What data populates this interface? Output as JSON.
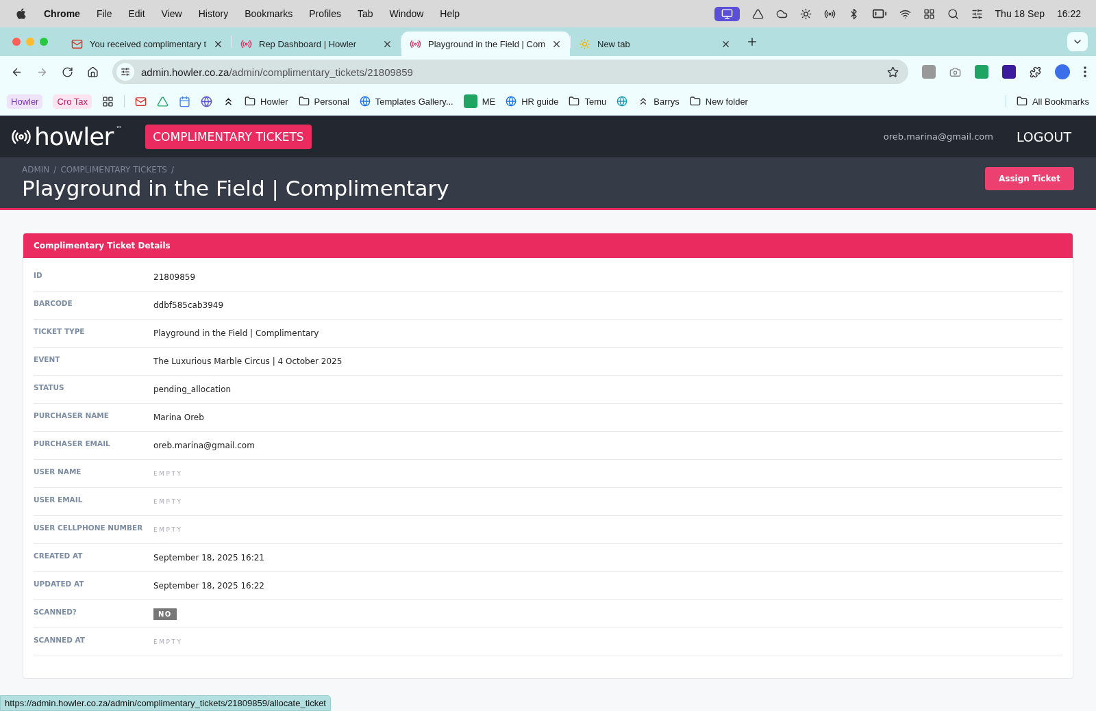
{
  "menu_bar": {
    "app": "Chrome",
    "menus": [
      "File",
      "Edit",
      "View",
      "History",
      "Bookmarks",
      "Profiles",
      "Tab",
      "Window",
      "Help"
    ],
    "date": "Thu 18 Sep",
    "time": "16:22"
  },
  "tabs": [
    {
      "title": "You received complimentary t",
      "kind": "mail",
      "selected": false
    },
    {
      "title": "Rep Dashboard | Howler",
      "kind": "howler",
      "selected": false
    },
    {
      "title": "Playground in the Field | Com",
      "kind": "howler",
      "selected": true
    },
    {
      "title": "New tab",
      "kind": "sun",
      "selected": false
    }
  ],
  "address_bar": {
    "host": "admin.howler.co.za",
    "path": "/admin/complimentary_tickets/21809859"
  },
  "bookmarks": [
    {
      "kind": "chip",
      "label": "Howler"
    },
    {
      "kind": "chip",
      "label": "Cro Tax"
    },
    {
      "kind": "apps"
    },
    {
      "kind": "divider"
    },
    {
      "kind": "mail"
    },
    {
      "kind": "drive"
    },
    {
      "kind": "calendar"
    },
    {
      "kind": "badge-app"
    },
    {
      "kind": "mark"
    },
    {
      "kind": "folder",
      "label": "Howler"
    },
    {
      "kind": "folder",
      "label": "Personal"
    },
    {
      "kind": "site",
      "label": "Templates Gallery..."
    },
    {
      "kind": "sheet",
      "label": "ME"
    },
    {
      "kind": "site",
      "label": "HR guide"
    },
    {
      "kind": "folder",
      "label": "Temu"
    },
    {
      "kind": "site"
    },
    {
      "kind": "chevrons",
      "label": "Barrys"
    },
    {
      "kind": "folder",
      "label": "New folder"
    }
  ],
  "all_bookmarks": "All Bookmarks",
  "app_header": {
    "logo": "howler",
    "logo_mark": "™",
    "section": "COMPLIMENTARY TICKETS",
    "user_email": "oreb.marina@gmail.com",
    "logout": "LOGOUT"
  },
  "breadcrumbs": [
    "ADMIN",
    "COMPLIMENTARY TICKETS"
  ],
  "breadcrumb_separator": "/",
  "page_title": "Playground in the Field | Complimentary",
  "assign_button": "Assign Ticket",
  "card": {
    "title": "Complimentary Ticket Details",
    "fields": [
      {
        "label": "ID",
        "kind": "text",
        "value": "21809859"
      },
      {
        "label": "BARCODE",
        "kind": "text",
        "value": "ddbf585cab3949"
      },
      {
        "label": "TICKET TYPE",
        "kind": "text",
        "value": "Playground in the Field | Complimentary"
      },
      {
        "label": "EVENT",
        "kind": "text",
        "value": "The Luxurious Marble Circus | 4 October 2025"
      },
      {
        "label": "STATUS",
        "kind": "text",
        "value": "pending_allocation"
      },
      {
        "label": "PURCHASER NAME",
        "kind": "text",
        "value": "Marina Oreb"
      },
      {
        "label": "PURCHASER EMAIL",
        "kind": "text",
        "value": "oreb.marina@gmail.com"
      },
      {
        "label": "USER NAME",
        "kind": "empty",
        "value": "EMPTY"
      },
      {
        "label": "USER EMAIL",
        "kind": "empty",
        "value": "EMPTY"
      },
      {
        "label": "USER CELLPHONE NUMBER",
        "kind": "empty",
        "value": "EMPTY"
      },
      {
        "label": "CREATED AT",
        "kind": "text",
        "value": "September 18, 2025 16:21"
      },
      {
        "label": "UPDATED AT",
        "kind": "text",
        "value": "September 18, 2025 16:22"
      },
      {
        "label": "SCANNED?",
        "kind": "badge",
        "value": "NO"
      },
      {
        "label": "SCANNED AT",
        "kind": "empty",
        "value": "EMPTY"
      }
    ]
  },
  "status_url": "https://admin.howler.co.za/admin/complimentary_tickets/21809859/allocate_ticket"
}
